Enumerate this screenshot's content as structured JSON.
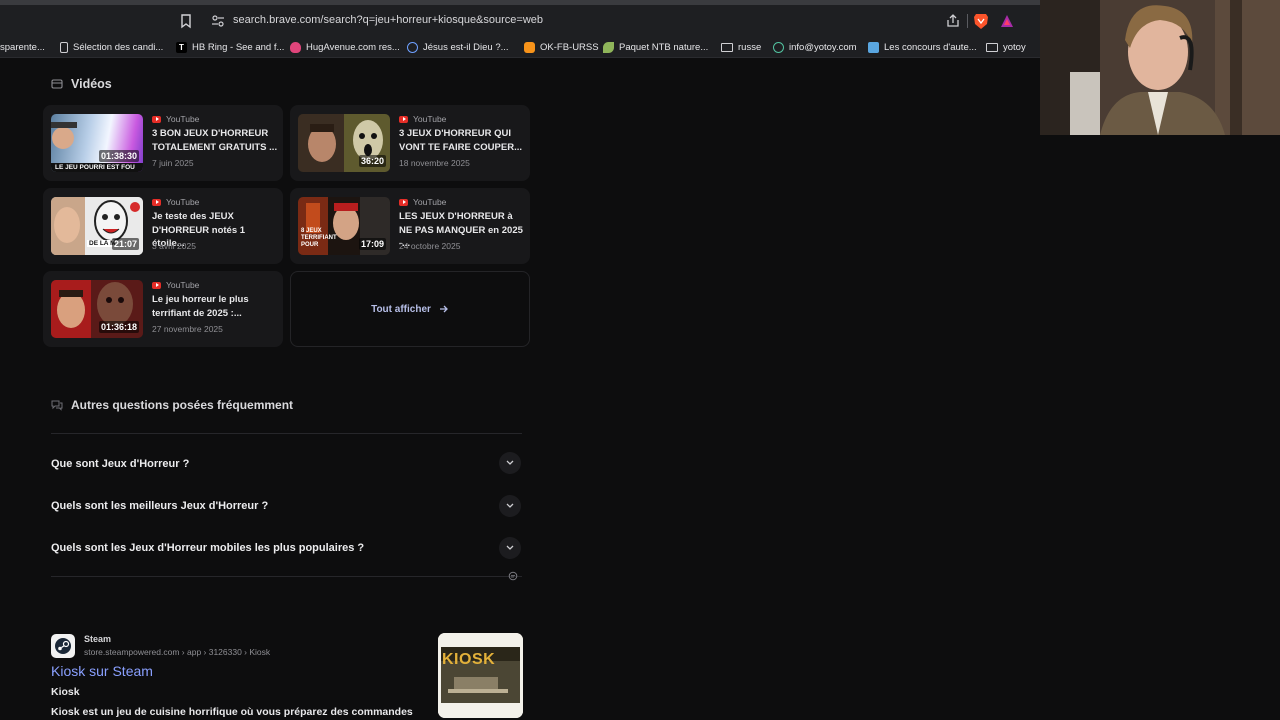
{
  "browser": {
    "url": "search.brave.com/search?q=jeu+horreur+kiosque&source=web",
    "bookmarks": [
      {
        "label": "sparente..."
      },
      {
        "label": "Sélection des candi..."
      },
      {
        "label": "HB Ring - See and f..."
      },
      {
        "label": "HugAvenue.com res..."
      },
      {
        "label": "Jésus est-il Dieu ?..."
      },
      {
        "label": "OK-FB-URSS"
      },
      {
        "label": "Paquet NTB nature..."
      },
      {
        "label": "russe"
      },
      {
        "label": "info@yotoy.com"
      },
      {
        "label": "Les concours d'aute..."
      },
      {
        "label": "yotoy"
      }
    ]
  },
  "videos": {
    "heading": "Vidéos",
    "items": [
      {
        "source": "YouTube",
        "title": "3 BON JEUX D'HORREUR TOTALEMENT GRATUITS ...",
        "date": "7 juin 2025",
        "duration": "01:38:30",
        "thumb_text": "LE JEU POURRI EST FOU"
      },
      {
        "source": "YouTube",
        "title": "3 JEUX D'HORREUR QUI VONT TE FAIRE COUPER...",
        "date": "18 novembre 2025",
        "duration": "36:20",
        "thumb_text": ""
      },
      {
        "source": "YouTube",
        "title": "Je teste des JEUX D'HORREUR notés 1 étoile...",
        "date": "3 avril 2025",
        "duration": "21:07",
        "thumb_text": "DE LA M"
      },
      {
        "source": "YouTube",
        "title": "LES JEUX D'HORREUR à NE PAS MANQUER en 2025 -...",
        "date": "24 octobre 2025",
        "duration": "17:09",
        "thumb_text": "8 JEUX TERRIFIANT POUR"
      },
      {
        "source": "YouTube",
        "title": "Le jeu horreur le plus terrifiant de 2025 :...",
        "date": "27 novembre 2025",
        "duration": "01:36:18",
        "thumb_text": ""
      }
    ],
    "show_all": "Tout afficher"
  },
  "faq": {
    "heading": "Autres questions posées fréquemment",
    "questions": [
      "Que sont Jeux d'Horreur ?",
      "Quels sont les meilleurs Jeux d'Horreur ?",
      "Quels sont les Jeux d'Horreur mobiles les plus populaires ?"
    ]
  },
  "result": {
    "site": "Steam",
    "path": "store.steampowered.com › app › 3126330 › Kiosk",
    "title": "Kiosk sur Steam",
    "subtitle": "Kiosk",
    "description": "Kiosk est un jeu de cuisine horrifique où vous préparez des commandes",
    "thumb_text": "KIOSK"
  },
  "colors": {
    "link": "#8aa0ff",
    "youtube": "#e52d27",
    "card_bg": "#18181a",
    "page_bg": "#0d0d0e"
  }
}
